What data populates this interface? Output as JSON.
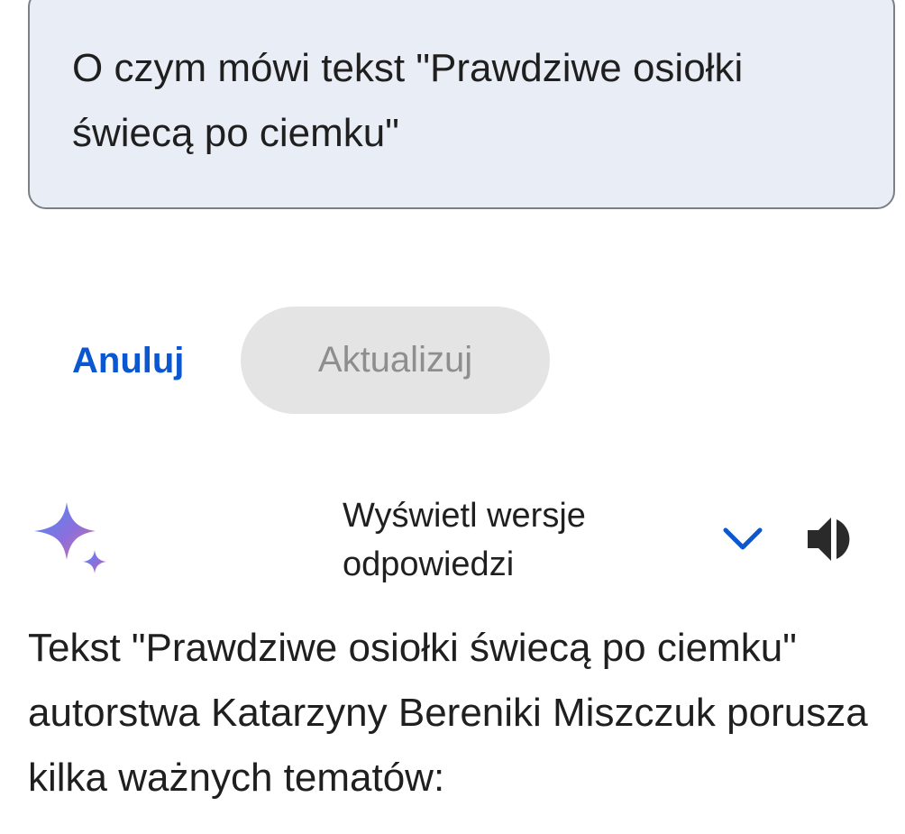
{
  "prompt": {
    "text": "O czym mówi tekst \"Prawdziwe osiołki świecą po ciemku\""
  },
  "actions": {
    "cancel_label": "Anuluj",
    "update_label": "Aktualizuj"
  },
  "response_header": {
    "versions_label": "Wyświetl wersje odpowiedzi",
    "sparkle_icon": "gemini-sparkle-icon",
    "chevron_icon": "chevron-down-icon",
    "speaker_icon": "speaker-icon"
  },
  "answer": {
    "text": "Tekst \"Prawdziwe osiołki świecą po ciemku\" autorstwa Katarzyny Bereniki Miszczuk porusza kilka ważnych tematów:"
  },
  "colors": {
    "accent": "#0b57d0",
    "prompt_bg": "#e9edf5",
    "disabled_button_bg": "#e4e4e4",
    "disabled_button_text": "#8e8e8e"
  }
}
